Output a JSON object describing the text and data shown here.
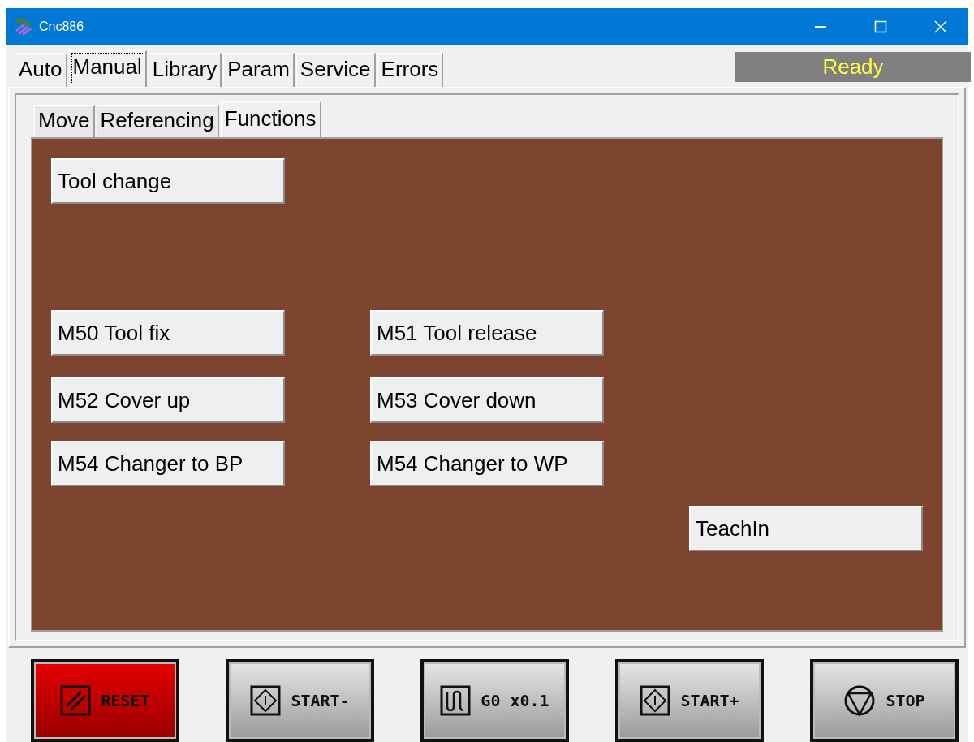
{
  "window": {
    "title": "Cnc886"
  },
  "tabs": [
    {
      "label": "Auto",
      "selected": false
    },
    {
      "label": "Manual",
      "selected": true
    },
    {
      "label": "Library",
      "selected": false
    },
    {
      "label": "Param",
      "selected": false
    },
    {
      "label": "Service",
      "selected": false
    },
    {
      "label": "Errors",
      "selected": false
    }
  ],
  "status": "Ready",
  "subtabs": [
    {
      "label": "Move",
      "selected": false
    },
    {
      "label": "Referencing",
      "selected": false
    },
    {
      "label": "Functions",
      "selected": true
    }
  ],
  "function_buttons": [
    "Tool change",
    "M50 Tool fix",
    "M51 Tool release",
    "M52 Cover up",
    "M53 Cover down",
    "M54 Changer to BP",
    "M54 Changer to WP",
    "TeachIn"
  ],
  "control_buttons": [
    {
      "kind": "reset",
      "label": "RESET"
    },
    {
      "kind": "start",
      "label": "START-"
    },
    {
      "kind": "rapid",
      "label": "G0 x0.1"
    },
    {
      "kind": "start",
      "label": "START+"
    },
    {
      "kind": "stop",
      "label": "STOP"
    }
  ]
}
